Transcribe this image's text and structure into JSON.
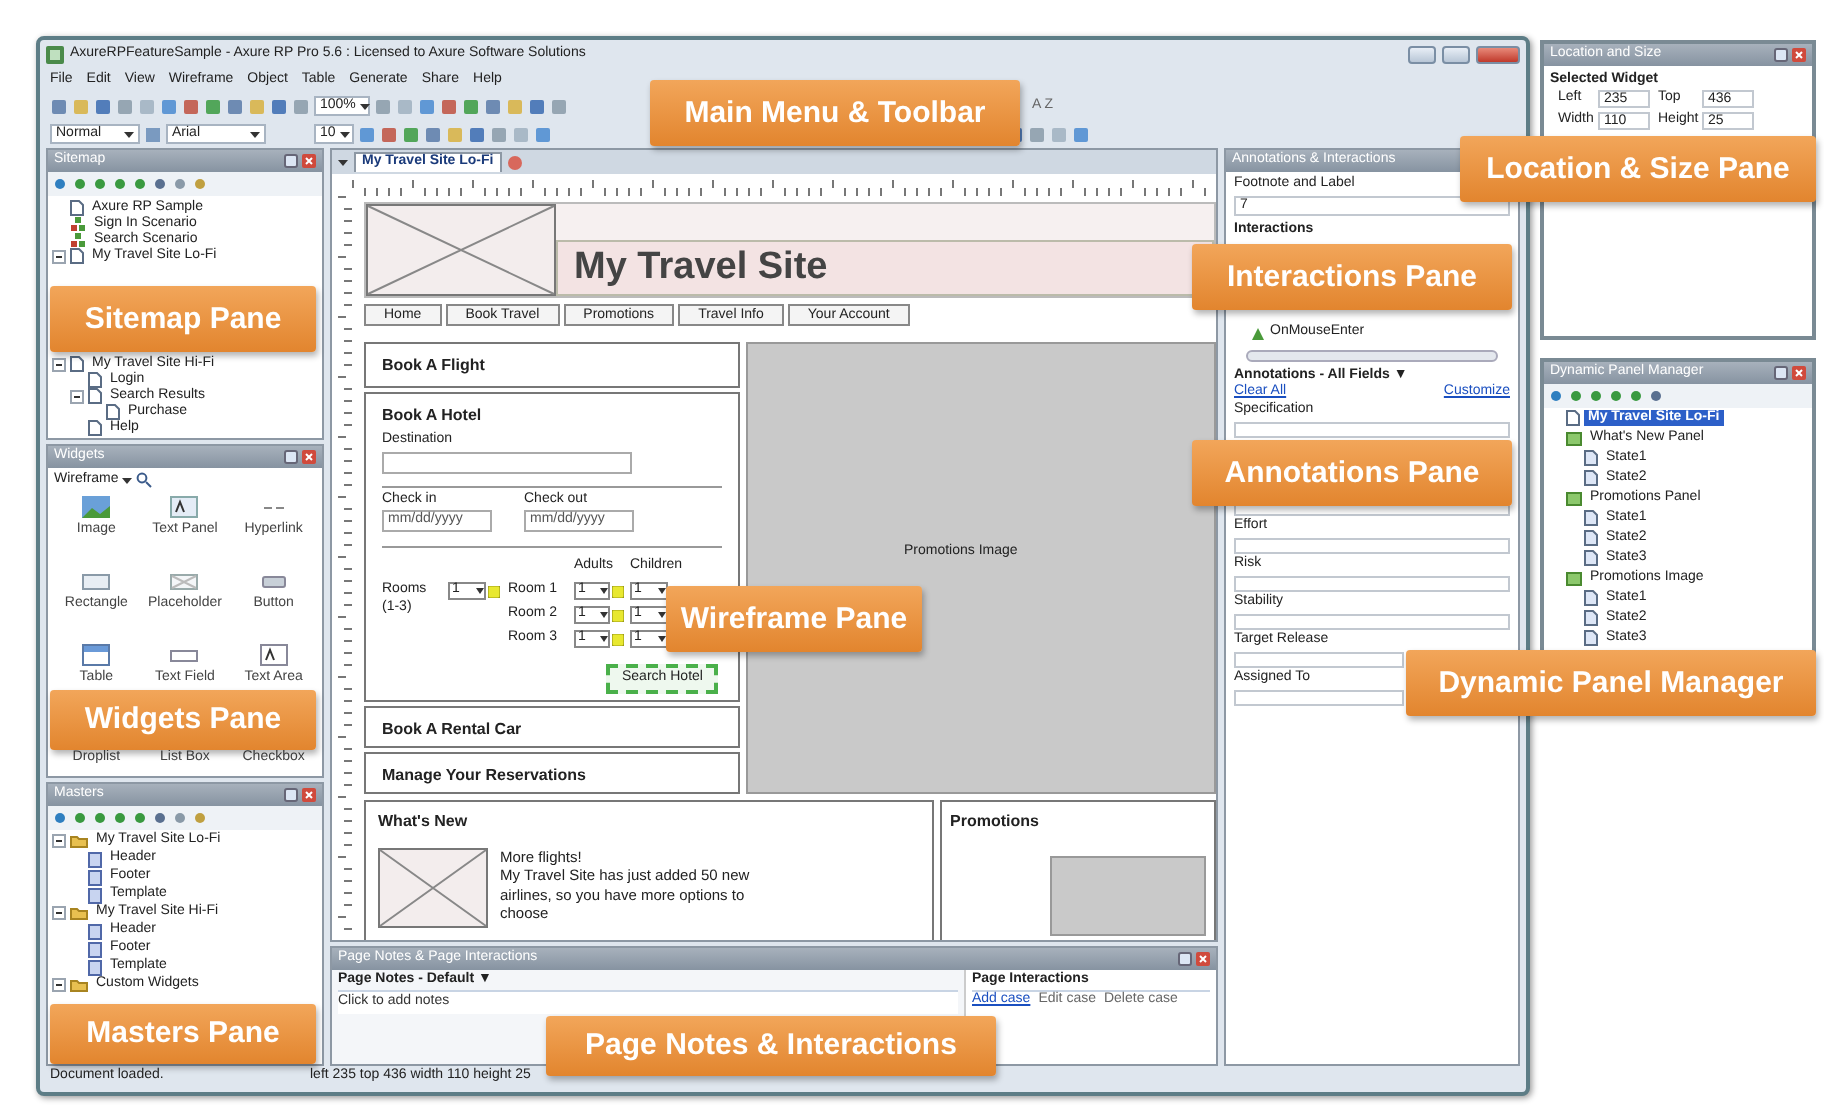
{
  "window": {
    "title": "AxureRPFeatureSample - Axure RP Pro 5.6 : Licensed to Axure Software Solutions"
  },
  "menu": [
    "File",
    "Edit",
    "View",
    "Wireframe",
    "Object",
    "Table",
    "Generate",
    "Share",
    "Help"
  ],
  "toolbar": {
    "zoom": "100%",
    "style": "Normal",
    "font": "Arial",
    "font_size": "10",
    "sort": "A Z"
  },
  "sitemap": {
    "title": "Sitemap",
    "items": [
      {
        "label": "Axure RP Sample",
        "kind": "page"
      },
      {
        "label": "Sign In Scenario",
        "kind": "flow"
      },
      {
        "label": "Search Scenario",
        "kind": "flow"
      },
      {
        "label": "My Travel Site Lo-Fi",
        "kind": "page",
        "expanded": true
      },
      {
        "label": "My Travel Site Hi-Fi",
        "kind": "page",
        "expanded": true,
        "children": [
          {
            "label": "Login",
            "kind": "page"
          },
          {
            "label": "Search Results",
            "kind": "page",
            "expanded": true,
            "children": [
              {
                "label": "Purchase",
                "kind": "page"
              }
            ]
          },
          {
            "label": "Help",
            "kind": "page"
          }
        ]
      }
    ]
  },
  "widgets": {
    "title": "Widgets",
    "library": "Wireframe",
    "items": [
      "Image",
      "Text Panel",
      "Hyperlink",
      "Rectangle",
      "Placeholder",
      "Button",
      "Table",
      "Text Field",
      "Text Area",
      "Droplist",
      "List Box",
      "Checkbox"
    ]
  },
  "masters": {
    "title": "Masters",
    "items": [
      {
        "label": "My Travel Site Lo-Fi",
        "kind": "folder",
        "expanded": true,
        "children": [
          {
            "label": "Header",
            "kind": "master"
          },
          {
            "label": "Footer",
            "kind": "master"
          },
          {
            "label": "Template",
            "kind": "master"
          }
        ]
      },
      {
        "label": "My Travel Site Hi-Fi",
        "kind": "folder",
        "expanded": true,
        "children": [
          {
            "label": "Header",
            "kind": "master"
          },
          {
            "label": "Footer",
            "kind": "master"
          },
          {
            "label": "Template",
            "kind": "master"
          }
        ]
      },
      {
        "label": "Custom Widgets",
        "kind": "folder",
        "expanded": true
      }
    ]
  },
  "wireframe": {
    "tab": {
      "label": "My Travel Site Lo-Fi",
      "selected": true
    },
    "site_title": "My Travel Site",
    "nav": [
      "Home",
      "Book Travel",
      "Promotions",
      "Travel Info",
      "Your Account"
    ],
    "book_flight": "Book A Flight",
    "hotel": {
      "title": "Book A Hotel",
      "destination_label": "Destination",
      "check_in": {
        "label": "Check in",
        "value": "mm/dd/yyyy"
      },
      "check_out": {
        "label": "Check out",
        "value": "mm/dd/yyyy"
      },
      "rooms_label": "Rooms (1-3)",
      "rooms_value": "1",
      "adults": "Adults",
      "children": "Children",
      "rooms": [
        {
          "label": "Room 1",
          "adults": "1",
          "children": "1"
        },
        {
          "label": "Room 2",
          "adults": "1",
          "children": "1"
        },
        {
          "label": "Room 3",
          "adults": "1",
          "children": "1"
        }
      ],
      "search": {
        "label": "Search Hotel",
        "selected": true
      }
    },
    "rental_car": "Book A Rental Car",
    "reservations": "Manage Your Reservations",
    "promotions_image": "Promotions Image",
    "whats_new": {
      "title": "What's New",
      "headline": "More flights!",
      "body": "My Travel Site has just added 50 new airlines, so you have more options to choose"
    },
    "promotions": {
      "title": "Promotions"
    }
  },
  "annotations": {
    "title": "Annotations & Interactions",
    "footnote_label": "Footnote and Label",
    "footnote": "7",
    "interactions_title": "Interactions",
    "interaction": "OnMouseEnter",
    "fields_title": "Annotations - All Fields ▼",
    "clear_all": "Clear All",
    "customize": "Customize",
    "fields": [
      "Specification",
      "Effort",
      "Risk",
      "Stability",
      "Target Release",
      "Assigned To"
    ]
  },
  "page_notes": {
    "title": "Page Notes & Page Interactions",
    "notes_title": "Page Notes - Default ▼",
    "placeholder": "Click to add notes",
    "interactions_title": "Page Interactions",
    "links": [
      "Add case",
      "Edit case",
      "Delete case"
    ]
  },
  "status_bar": {
    "message": "Document loaded.",
    "geometry": "left 235  top 436  width 110  height 25"
  },
  "location_size": {
    "title": "Location and Size",
    "heading": "Selected Widget",
    "fields": [
      {
        "label": "Left",
        "value": "235"
      },
      {
        "label": "Top",
        "value": "436"
      },
      {
        "label": "Width",
        "value": "110"
      },
      {
        "label": "Height",
        "value": "25"
      }
    ]
  },
  "dynamic_panels": {
    "title": "Dynamic Panel Manager",
    "items": [
      {
        "label": "My Travel Site Lo-Fi",
        "kind": "page",
        "selected": true
      },
      {
        "label": "What's New Panel",
        "kind": "panel",
        "selected": false,
        "children": [
          {
            "label": "State1",
            "kind": "state",
            "selected": false
          },
          {
            "label": "State2",
            "kind": "state",
            "selected": false
          }
        ]
      },
      {
        "label": "Promotions Panel",
        "kind": "panel",
        "selected": false,
        "children": [
          {
            "label": "State1",
            "kind": "state",
            "selected": false
          },
          {
            "label": "State2",
            "kind": "state",
            "selected": false
          },
          {
            "label": "State3",
            "kind": "state",
            "selected": false
          }
        ]
      },
      {
        "label": "Promotions Image",
        "kind": "panel",
        "selected": false,
        "children": [
          {
            "label": "State1",
            "kind": "state",
            "selected": false
          },
          {
            "label": "State2",
            "kind": "state",
            "selected": false
          },
          {
            "label": "State3",
            "kind": "state",
            "selected": false
          }
        ]
      }
    ]
  },
  "callouts": [
    {
      "kind": "menu",
      "label": "Main Menu & Toolbar"
    },
    {
      "kind": "location",
      "label": "Location & Size Pane"
    },
    {
      "kind": "interactions",
      "label": "Interactions Pane"
    },
    {
      "kind": "sitemap",
      "label": "Sitemap Pane"
    },
    {
      "kind": "annotations",
      "label": "Annotations Pane"
    },
    {
      "kind": "wireframe",
      "label": "Wireframe Pane"
    },
    {
      "kind": "dpm",
      "label": "Dynamic Panel Manager"
    },
    {
      "kind": "widgets",
      "label": "Widgets Pane"
    },
    {
      "kind": "masters",
      "label": "Masters Pane"
    },
    {
      "kind": "pagenotes",
      "label": "Page Notes & Interactions"
    }
  ]
}
